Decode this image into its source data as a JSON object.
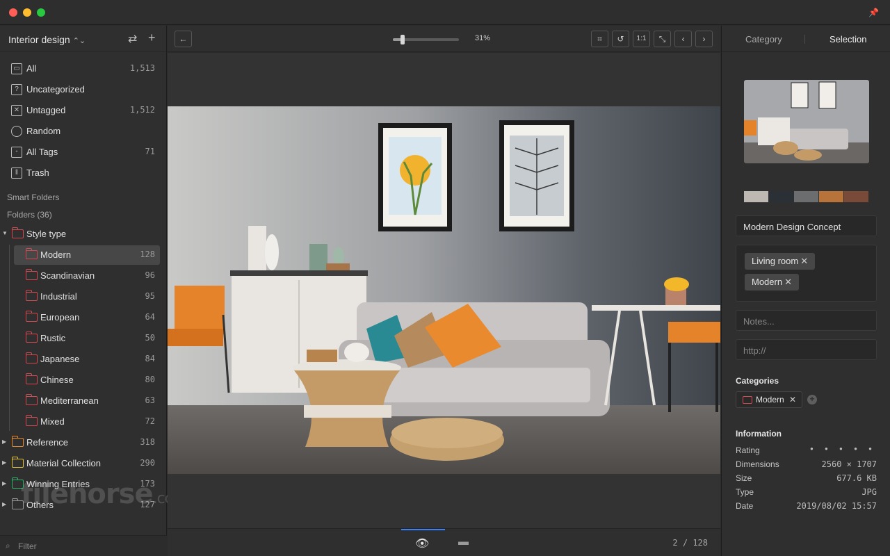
{
  "library": {
    "title": "Interior design"
  },
  "nav": [
    {
      "label": "All",
      "count": "1,513",
      "icon": "archive-icon"
    },
    {
      "label": "Uncategorized",
      "count": "",
      "icon": "question-icon"
    },
    {
      "label": "Untagged",
      "count": "1,512",
      "icon": "untagged-icon"
    },
    {
      "label": "Random",
      "count": "",
      "icon": "lightbulb-icon"
    },
    {
      "label": "All Tags",
      "count": "71",
      "icon": "tag-icon"
    },
    {
      "label": "Trash",
      "count": "",
      "icon": "trash-icon"
    }
  ],
  "sections": {
    "smart": "Smart Folders",
    "folders": "Folders (36)"
  },
  "folders": {
    "style": {
      "label": "Style type",
      "color": "#d14a52"
    },
    "children": [
      {
        "label": "Modern",
        "count": "128"
      },
      {
        "label": "Scandinavian",
        "count": "96"
      },
      {
        "label": "Industrial",
        "count": "95"
      },
      {
        "label": "European",
        "count": "64"
      },
      {
        "label": "Rustic",
        "count": "50"
      },
      {
        "label": "Japanese",
        "count": "84"
      },
      {
        "label": "Chinese",
        "count": "80"
      },
      {
        "label": "Mediterranean",
        "count": "63"
      },
      {
        "label": "Mixed",
        "count": "72"
      }
    ],
    "others": [
      {
        "label": "Reference",
        "count": "318",
        "color": "#e88a2f"
      },
      {
        "label": "Material Collection",
        "count": "290",
        "color": "#e0c23a"
      },
      {
        "label": "Winning Entries",
        "count": "173",
        "color": "#2fb36a"
      },
      {
        "label": "Others",
        "count": "127",
        "color": "#9a9a9a"
      }
    ]
  },
  "filter": {
    "placeholder": "Filter"
  },
  "watermark": {
    "text": "filehorse",
    "suffix": ".com"
  },
  "toolbar": {
    "zoom": "31%",
    "zoom_fraction": 0.15,
    "ratio_label": "1:1"
  },
  "bottom": {
    "pager": "2 / 128"
  },
  "panel": {
    "tab_category": "Category",
    "tab_selection": "Selection",
    "palette": [
      "#bdb9b2",
      "#2b2f36",
      "#6c6d6f",
      "#b8733a",
      "#7a4a38"
    ],
    "name": "Modern Design Concept",
    "tags": [
      "Living room",
      "Modern"
    ],
    "notes_placeholder": "Notes...",
    "url_placeholder": "http://",
    "categories_title": "Categories",
    "category": "Modern",
    "info_title": "Information",
    "info": [
      {
        "key": "Rating",
        "value": "● ● ● ● ●"
      },
      {
        "key": "Dimensions",
        "value": "2560 × 1707"
      },
      {
        "key": "Size",
        "value": "677.6 KB"
      },
      {
        "key": "Type",
        "value": "JPG"
      },
      {
        "key": "Date",
        "value": "2019/08/02 15:57"
      }
    ]
  }
}
